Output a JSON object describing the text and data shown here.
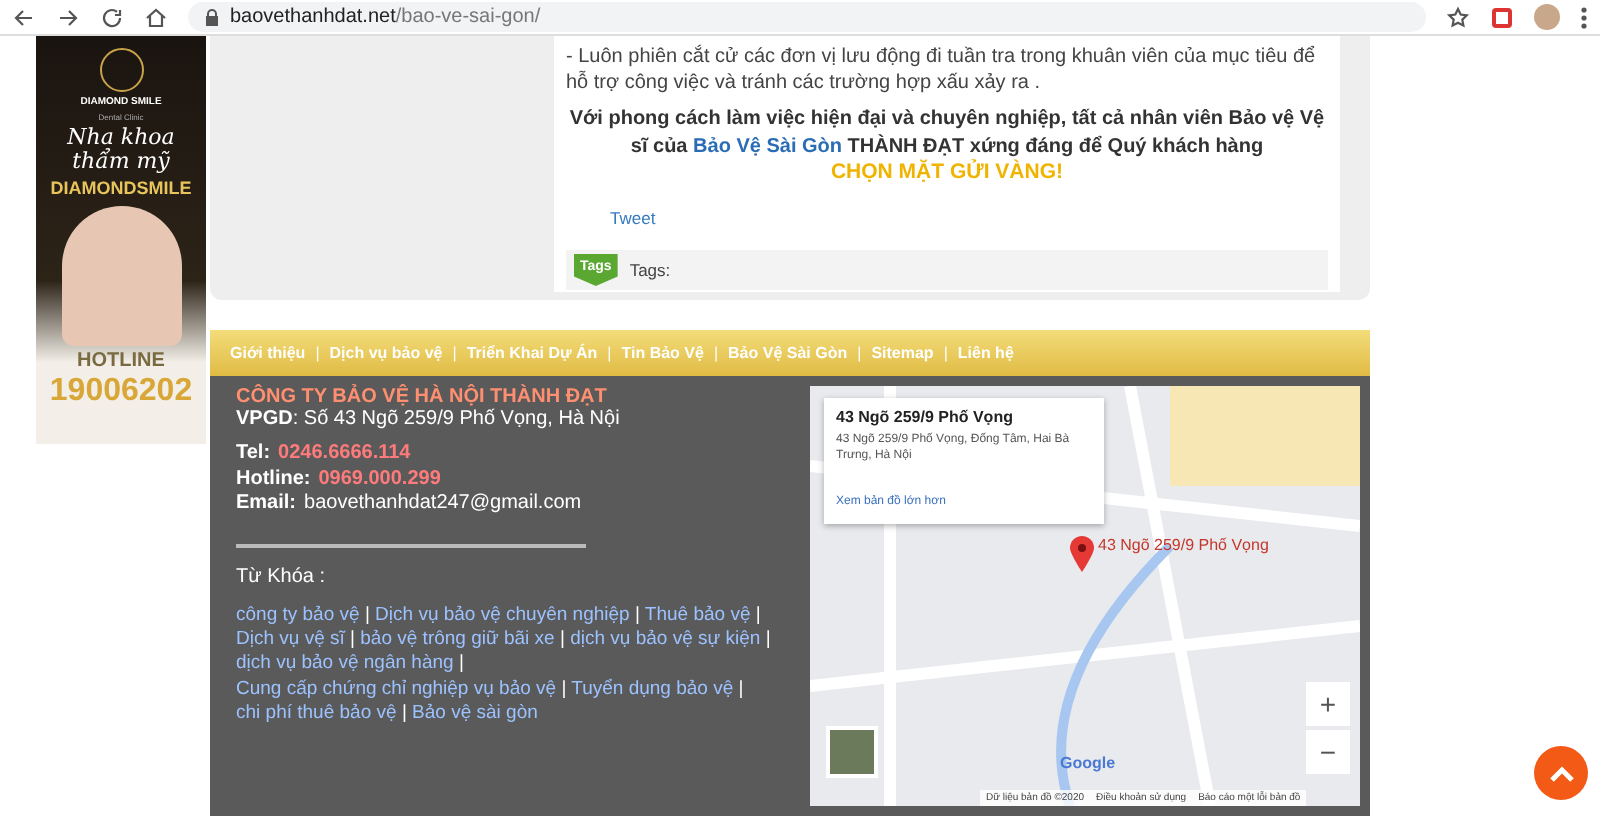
{
  "browser": {
    "url_host": "baovethanhdat.net",
    "url_path": "/bao-ve-sai-gon/"
  },
  "ad_banner": {
    "brand": "DIAMOND SMILE",
    "brand_sub": "Dental Clinic",
    "slogan": "Nha khoa thẩm mỹ",
    "brand_big": "DIAMONDSMILE",
    "hotline_label": "HOTLINE",
    "hotline_number": "19006202"
  },
  "article": {
    "paragraph": "- Luôn phiên cắt cử các đơn vị lưu động đi tuần tra trong khuân viên của mục tiêu để hỗ trợ công việc và tránh các trường hợp xấu xảy ra .",
    "closing_before": "Với phong cách làm việc hiện đại và chuyên nghiệp, tất cả nhân viên Bảo vệ Vệ sĩ của",
    "closing_link": "Bảo Vệ Sài Gòn",
    "closing_after": "THÀNH ĐẠT xứng đáng để Quý khách hàng",
    "highlight": "CHỌN MẶT GỬI VÀNG!",
    "tweet": "Tweet",
    "tags_badge": "Tags",
    "tags_label": "Tags:"
  },
  "nav": {
    "separator": "|",
    "items": [
      {
        "label": "Giới thiệu"
      },
      {
        "label": "Dịch vụ bảo vệ"
      },
      {
        "label": "Triển Khai Dự Án"
      },
      {
        "label": "Tin Bảo Vệ"
      },
      {
        "label": "Bảo Vệ Sài Gòn"
      },
      {
        "label": "Sitemap"
      },
      {
        "label": "Liên hệ"
      }
    ]
  },
  "footer": {
    "company": "CÔNG TY BẢO VỆ HÀ NỘI THÀNH ĐẠT",
    "address": "**VPGD**: Số 43 Ngõ 259/9 Phố Vọng, Hà Nội",
    "contacts": [
      {
        "label": "Tel:",
        "value": "0246.6666.114",
        "kind": "phone"
      },
      {
        "label": "Hotline:",
        "value": "0969.000.299",
        "kind": "phone"
      },
      {
        "label": "Email:",
        "value": "baovethanhdat247@gmail.com",
        "kind": "email"
      }
    ],
    "keywords_title": "Từ Khóa :",
    "separator": "|",
    "keywords": [
      "công ty bảo vệ",
      "Dịch vụ bảo vệ chuyên nghiệp",
      "Thuê bảo vệ",
      "Dịch vụ vệ sĩ",
      "bảo vệ trông giữ bãi xe",
      "dịch vụ bảo vệ sự kiện",
      "dịch vụ bảo vệ ngân hàng",
      "Cung cấp chứng chỉ nghiệp vụ bảo vệ",
      "Tuyển dụng bảo vệ",
      "chi phí thuê bảo vệ",
      "Bảo vệ sài gòn"
    ]
  },
  "map": {
    "info_title": "43 Ngõ 259/9 Phố Vọng",
    "info_address": "43 Ngõ 259/9 Phố Vọng, Đống Tâm, Hai Bà Trưng, Hà Nội",
    "info_link": "Xem bản đồ lớn hơn",
    "marker_label": "43 Ngõ 259/9 Phố Vọng",
    "zoom_in": "+",
    "zoom_out": "−",
    "logo": "Google",
    "attribution": [
      "Dữ liệu bản đồ ©2020",
      "Điều khoản sử dụng",
      "Báo cáo một lỗi bản đồ"
    ]
  }
}
